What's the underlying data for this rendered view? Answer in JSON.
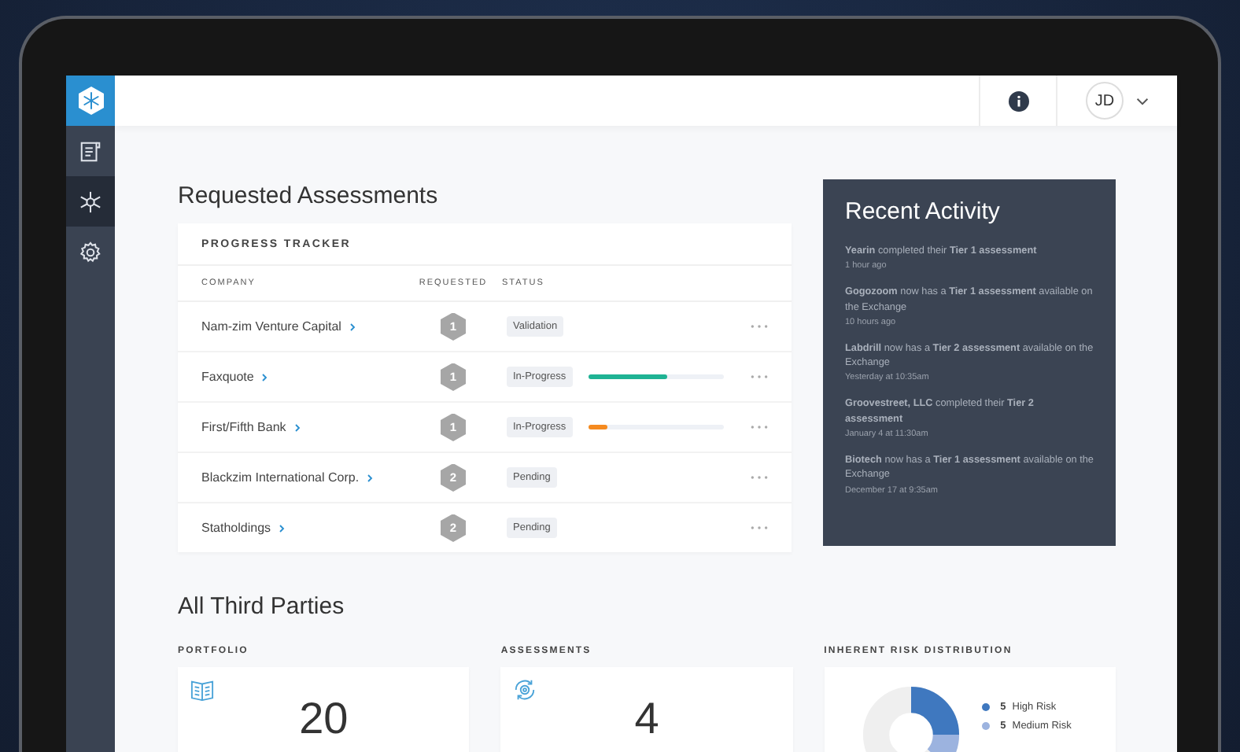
{
  "sidebar": {
    "items": [
      {
        "kind": "document",
        "selected": false
      },
      {
        "kind": "hub",
        "selected": true
      },
      {
        "kind": "gear",
        "selected": false
      }
    ]
  },
  "header": {
    "avatar_initials": "JD"
  },
  "requested_assessments": {
    "title": "Requested Assessments",
    "tracker_title": "PROGRESS TRACKER",
    "columns": [
      "COMPANY",
      "REQUESTED",
      "STATUS"
    ],
    "rows": [
      {
        "company": "Nam-zim Venture Capital",
        "requested": "1",
        "status": "Validation"
      },
      {
        "company": "Faxquote",
        "requested": "1",
        "status": "In-Progress",
        "progress": {
          "level": 0.58,
          "color": "#1fb394"
        }
      },
      {
        "company": "First/Fifth Bank",
        "requested": "1",
        "status": "In-Progress",
        "progress": {
          "level": 0.14,
          "color": "#f58a1f"
        }
      },
      {
        "company": "Blackzim International Corp.",
        "requested": "2",
        "status": "Pending"
      },
      {
        "company": "Statholdings",
        "requested": "2",
        "status": "Pending"
      }
    ]
  },
  "recent_activity": {
    "title": "Recent Activity",
    "entries": [
      {
        "text": "**Yearin** completed their **Tier 1 assessment**",
        "time": "1 hour ago"
      },
      {
        "text": "**Gogozoom** now has a **Tier 1 assessment** available on the Exchange",
        "time": "10 hours ago"
      },
      {
        "text": "**Labdrill** now has a **Tier 2 assessment** available on the Exchange",
        "time": "Yesterday at 10:35am"
      },
      {
        "text": "**Groovestreet, LLC** completed their **Tier 2 assessment**",
        "time": "January 4 at 11:30am"
      },
      {
        "text": "**Biotech** now has a **Tier 1 assessment** available on the Exchange",
        "time": "December 17 at 9:35am"
      }
    ]
  },
  "third_parties": {
    "title": "All Third Parties",
    "portfolio": {
      "label": "PORTFOLIO",
      "value": "20"
    },
    "assessments": {
      "label": "ASSESSMENTS",
      "value": "4"
    },
    "risk_distribution": {
      "label": "INHERENT RISK DISTRIBUTION",
      "legend": [
        {
          "count": "5",
          "label": "High Risk",
          "color": "#3f78bf"
        },
        {
          "count": "5",
          "label": "Medium Risk",
          "color": "#9cb3df"
        }
      ]
    }
  }
}
